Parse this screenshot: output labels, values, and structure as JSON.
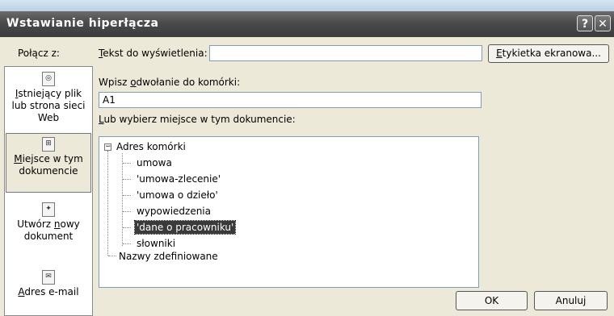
{
  "window": {
    "title": "Wstawianie hiperłącza",
    "help_label": "?",
    "close_label": "✕"
  },
  "left": {
    "header": "Połącz z:",
    "items": [
      {
        "l1": "I",
        "l1rest": "stniejący plik",
        "l2": "lub strona sieci",
        "l3": "Web",
        "icon": "existing-file-icon"
      },
      {
        "l1": "M",
        "l1rest": "iejsce w tym",
        "l2": "dokumencie",
        "icon": "place-in-document-icon"
      },
      {
        "l1": "Utwórz ",
        "l1u": "n",
        "l1rest": "owy",
        "l2": "dokument",
        "icon": "new-document-icon"
      },
      {
        "l1": "A",
        "l1rest": "dres e-mail",
        "icon": "email-icon"
      }
    ]
  },
  "display_text": {
    "label_u": "T",
    "label_rest": "ekst do wyświetlenia:",
    "value": ""
  },
  "screentip_button": {
    "u": "E",
    "rest": "tykietka ekranowa..."
  },
  "cell_ref": {
    "label_pre": "Wpisz ",
    "label_u": "o",
    "label_rest": "dwołanie do komórki:",
    "value": "A1"
  },
  "place_list": {
    "label_u": "L",
    "label_rest": "ub wybierz miejsce w tym dokumencie:"
  },
  "tree": {
    "root": "Adres komórki",
    "expander": "−",
    "children": [
      "umowa",
      "'umowa-zlecenie'",
      "'umowa o dzieło'",
      "wypowiedzenia",
      "'dane o pracowniku'",
      "słowniki"
    ],
    "selected_index": 4,
    "root2": "Nazwy zdefiniowane"
  },
  "buttons": {
    "ok": "OK",
    "cancel": "Anuluj"
  }
}
